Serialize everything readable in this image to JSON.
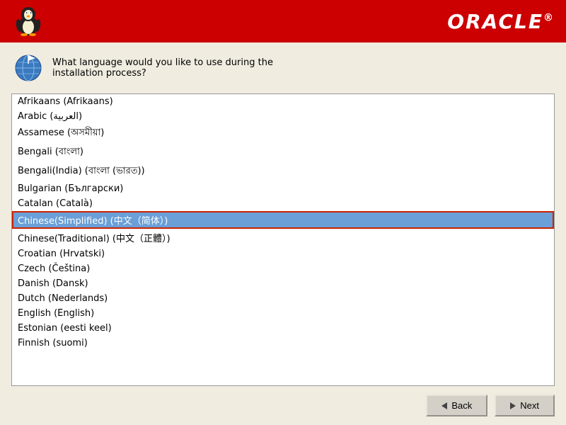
{
  "header": {
    "oracle_logo": "ORACLE",
    "oracle_reg": "®"
  },
  "question": {
    "text_line1": "What language would you like to use during the",
    "text_line2": "installation process?"
  },
  "languages": [
    {
      "id": "afrikaans",
      "label": "Afrikaans (Afrikaans)",
      "selected": false
    },
    {
      "id": "arabic",
      "label": "Arabic (العربية)",
      "selected": false
    },
    {
      "id": "assamese",
      "label": "Assamese (অসমীয়া)",
      "selected": false
    },
    {
      "id": "bengali",
      "label": "Bengali (বাংলা)",
      "selected": false
    },
    {
      "id": "bengali-india",
      "label": "Bengali(India) (বাংলা (ভারত))",
      "selected": false
    },
    {
      "id": "bulgarian",
      "label": "Bulgarian (Български)",
      "selected": false
    },
    {
      "id": "catalan",
      "label": "Catalan (Català)",
      "selected": false
    },
    {
      "id": "chinese-simplified",
      "label": "Chinese(Simplified) (中文（简体）)",
      "selected": true
    },
    {
      "id": "chinese-traditional",
      "label": "Chinese(Traditional) (中文（正體）)",
      "selected": false
    },
    {
      "id": "croatian",
      "label": "Croatian (Hrvatski)",
      "selected": false
    },
    {
      "id": "czech",
      "label": "Czech (Čeština)",
      "selected": false
    },
    {
      "id": "danish",
      "label": "Danish (Dansk)",
      "selected": false
    },
    {
      "id": "dutch",
      "label": "Dutch (Nederlands)",
      "selected": false
    },
    {
      "id": "english",
      "label": "English (English)",
      "selected": false
    },
    {
      "id": "estonian",
      "label": "Estonian (eesti keel)",
      "selected": false
    },
    {
      "id": "finnish",
      "label": "Finnish (suomi)",
      "selected": false
    }
  ],
  "buttons": {
    "back_label": "Back",
    "next_label": "Next"
  }
}
